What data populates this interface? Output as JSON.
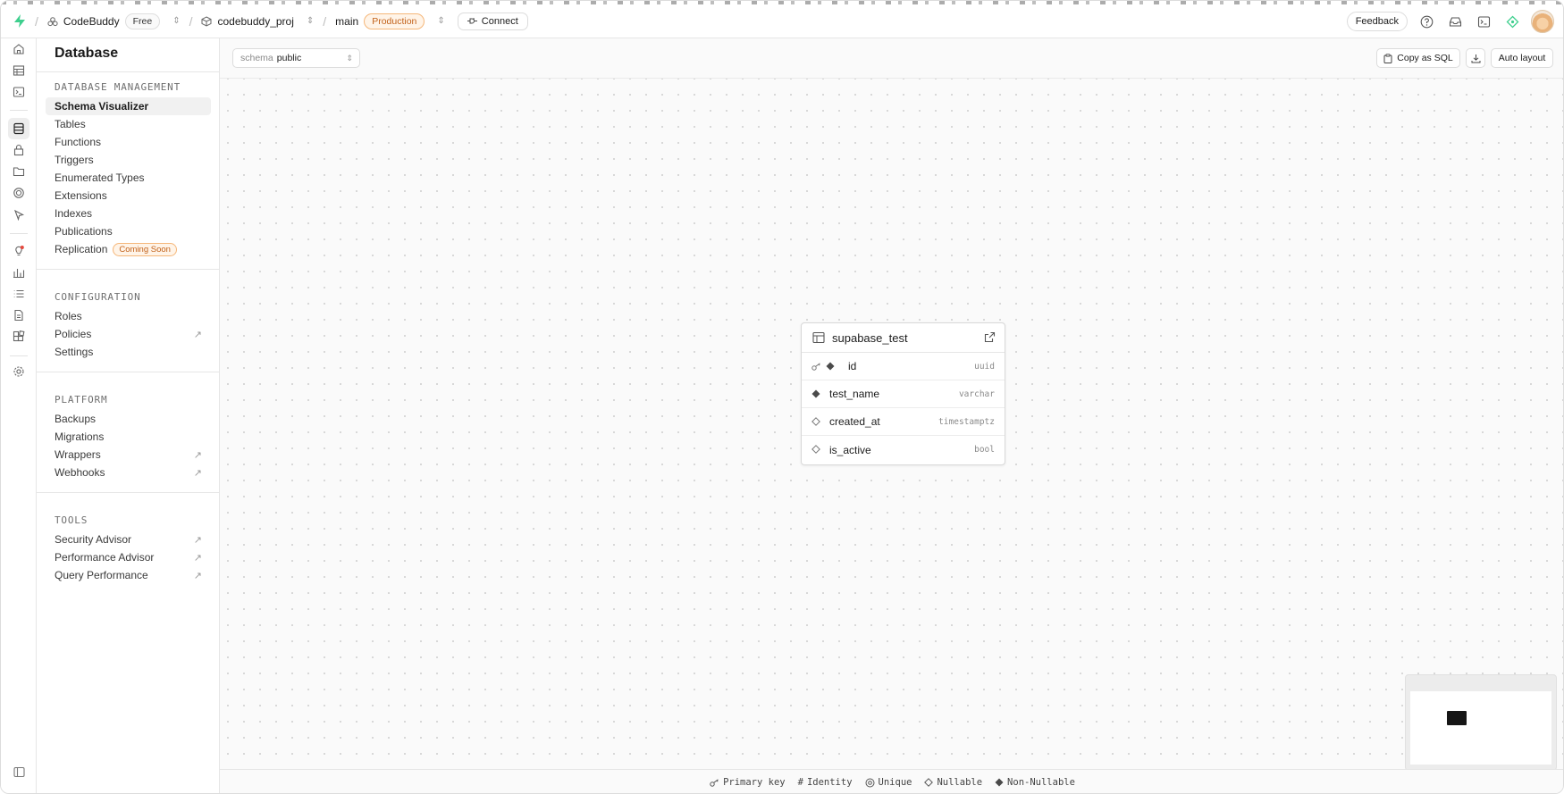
{
  "header": {
    "org_name": "CodeBuddy",
    "org_plan": "Free",
    "project_name": "codebuddy_proj",
    "branch_name": "main",
    "branch_env": "Production",
    "connect_label": "Connect",
    "feedback_label": "Feedback"
  },
  "rail": {
    "icons": [
      "home-icon",
      "table-editor-icon",
      "sql-editor-icon",
      "database-icon",
      "auth-icon",
      "storage-icon",
      "edge-functions-icon",
      "realtime-icon",
      "advisors-icon",
      "reports-icon",
      "logs-icon",
      "api-docs-icon",
      "integrations-icon",
      "settings-icon",
      "sidebar-toggle-icon"
    ],
    "active": "database-icon"
  },
  "sidebar": {
    "title": "Database",
    "sections": [
      {
        "title": "DATABASE MANAGEMENT",
        "items": [
          {
            "label": "Schema Visualizer",
            "active": true
          },
          {
            "label": "Tables"
          },
          {
            "label": "Functions"
          },
          {
            "label": "Triggers"
          },
          {
            "label": "Enumerated Types"
          },
          {
            "label": "Extensions"
          },
          {
            "label": "Indexes"
          },
          {
            "label": "Publications"
          },
          {
            "label": "Replication",
            "badge": "Coming Soon"
          }
        ]
      },
      {
        "title": "CONFIGURATION",
        "items": [
          {
            "label": "Roles"
          },
          {
            "label": "Policies",
            "external": true
          },
          {
            "label": "Settings"
          }
        ]
      },
      {
        "title": "PLATFORM",
        "items": [
          {
            "label": "Backups"
          },
          {
            "label": "Migrations"
          },
          {
            "label": "Wrappers",
            "external": true
          },
          {
            "label": "Webhooks",
            "external": true
          }
        ]
      },
      {
        "title": "TOOLS",
        "items": [
          {
            "label": "Security Advisor",
            "external": true
          },
          {
            "label": "Performance Advisor",
            "external": true
          },
          {
            "label": "Query Performance",
            "external": true
          }
        ]
      }
    ]
  },
  "toolbar": {
    "schema_label": "schema",
    "schema_value": "public",
    "copy_sql_label": "Copy as SQL",
    "auto_layout_label": "Auto layout"
  },
  "table_node": {
    "name": "supabase_test",
    "columns": [
      {
        "name": "id",
        "type": "uuid",
        "primary_key": true,
        "nullable": false
      },
      {
        "name": "test_name",
        "type": "varchar",
        "primary_key": false,
        "nullable": false
      },
      {
        "name": "created_at",
        "type": "timestamptz",
        "primary_key": false,
        "nullable": true
      },
      {
        "name": "is_active",
        "type": "bool",
        "primary_key": false,
        "nullable": true
      }
    ]
  },
  "legend": {
    "primary_key": "Primary key",
    "identity": "Identity",
    "unique": "Unique",
    "nullable": "Nullable",
    "non_nullable": "Non-Nullable"
  },
  "colors": {
    "brand": "#3ecf8e",
    "production_badge": "#c2621a",
    "active_bg": "#f1f1f1"
  }
}
